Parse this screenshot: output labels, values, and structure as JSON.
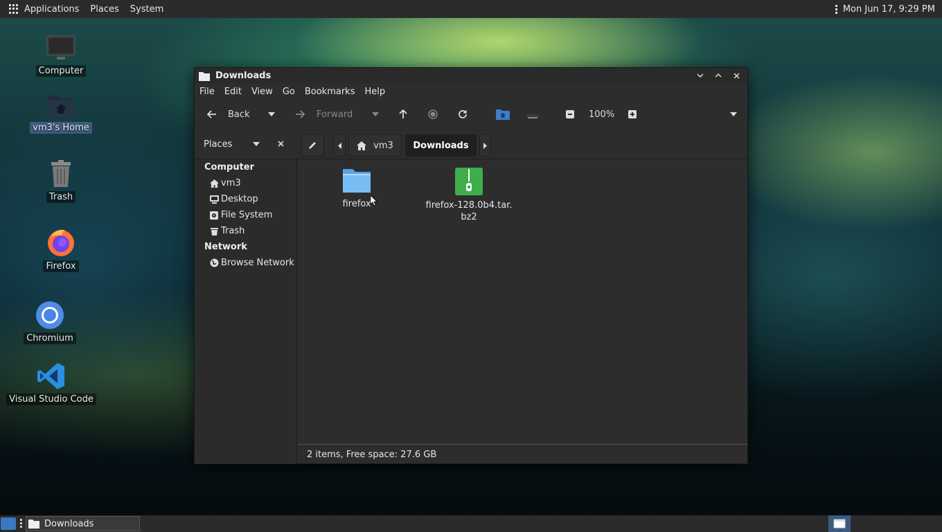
{
  "top_panel": {
    "menus": [
      "Applications",
      "Places",
      "System"
    ],
    "clock": "Mon Jun 17,  9:29 PM"
  },
  "desktop": {
    "icons": [
      {
        "label": "Computer",
        "icon": "computer-icon"
      },
      {
        "label": "vm3's Home",
        "icon": "home-folder-icon",
        "selected": true
      },
      {
        "label": "Trash",
        "icon": "trash-icon"
      },
      {
        "label": "Firefox",
        "icon": "firefox-icon"
      },
      {
        "label": "Chromium",
        "icon": "chromium-icon"
      },
      {
        "label": "Visual Studio Code",
        "icon": "vscode-icon"
      }
    ]
  },
  "window": {
    "title": "Downloads",
    "menubar": [
      "File",
      "Edit",
      "View",
      "Go",
      "Bookmarks",
      "Help"
    ],
    "toolbar": {
      "back_label": "Back",
      "forward_label": "Forward",
      "zoom": "100%"
    },
    "location": {
      "places_label": "Places",
      "crumbs": [
        "vm3",
        "Downloads"
      ]
    },
    "sidebar": {
      "sections": [
        {
          "title": "Computer",
          "items": [
            {
              "label": "vm3",
              "icon": "home-icon"
            },
            {
              "label": "Desktop",
              "icon": "desktop-icon"
            },
            {
              "label": "File System",
              "icon": "drive-icon"
            },
            {
              "label": "Trash",
              "icon": "trash-icon"
            }
          ]
        },
        {
          "title": "Network",
          "items": [
            {
              "label": "Browse Network",
              "icon": "network-icon"
            }
          ]
        }
      ]
    },
    "files": [
      {
        "name": "firefox",
        "icon": "folder-icon"
      },
      {
        "name": "firefox-128.0b4.tar.bz2",
        "icon": "archive-icon"
      }
    ],
    "status": "2 items, Free space: 27.6 GB"
  },
  "bottom_panel": {
    "task_label": "Downloads"
  },
  "colors": {
    "panel": "#2b2b2b",
    "window_bg": "#2d2d2d",
    "selection": "#3d5a80",
    "folder": "#6fb3f0",
    "archive": "#3fae4a"
  }
}
